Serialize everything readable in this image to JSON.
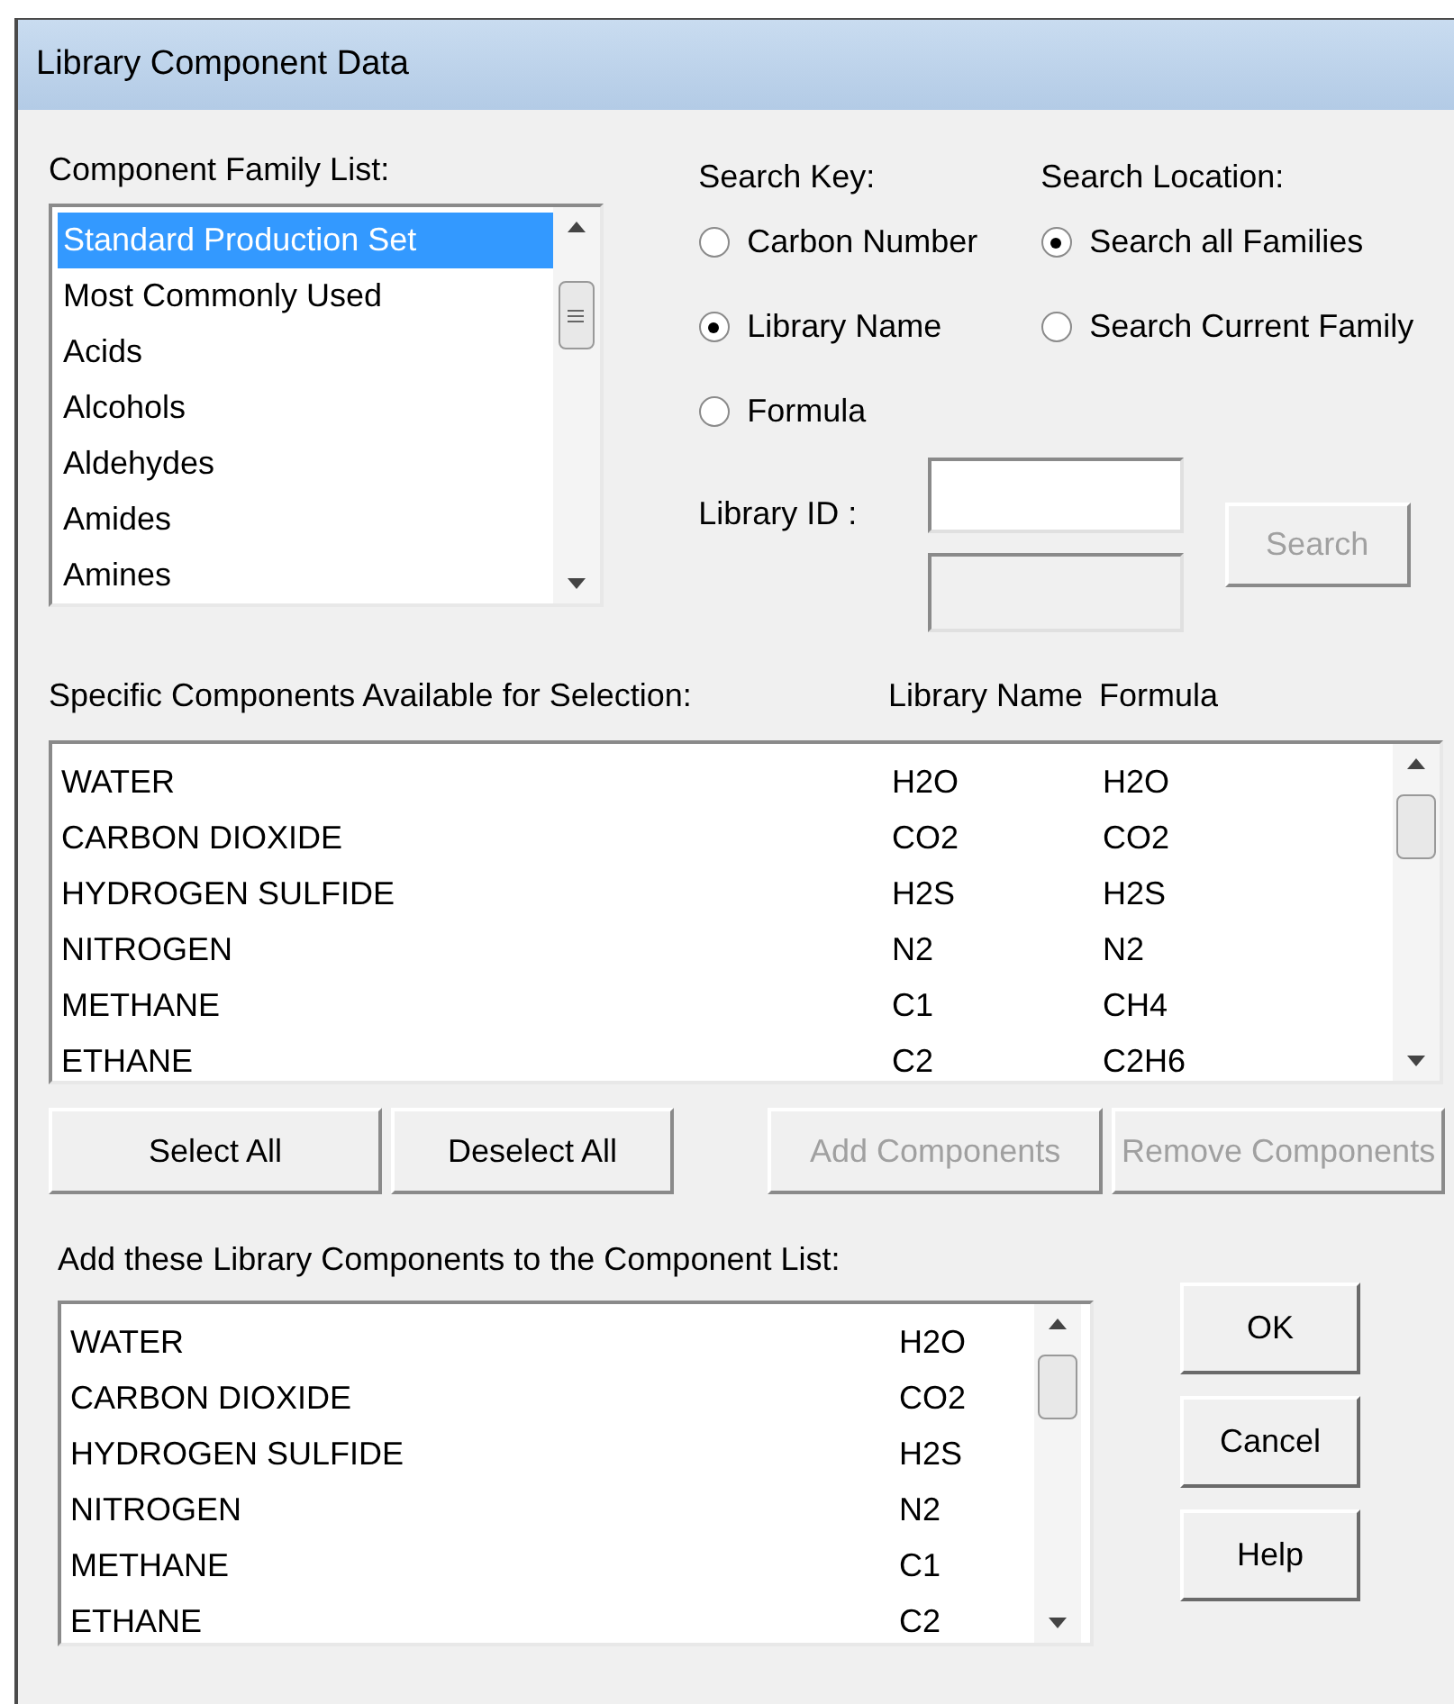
{
  "window": {
    "title": "Library Component Data"
  },
  "family_list": {
    "label": "Component Family List:",
    "items": [
      {
        "text": "Standard Production Set",
        "selected": true
      },
      {
        "text": "Most Commonly Used",
        "selected": false
      },
      {
        "text": "Acids",
        "selected": false
      },
      {
        "text": "Alcohols",
        "selected": false
      },
      {
        "text": "Aldehydes",
        "selected": false
      },
      {
        "text": "Amides",
        "selected": false
      },
      {
        "text": "Amines",
        "selected": false
      }
    ]
  },
  "search_key": {
    "label": "Search Key:",
    "options": [
      {
        "label": "Carbon Number",
        "selected": false
      },
      {
        "label": "Library Name",
        "selected": true
      },
      {
        "label": "Formula",
        "selected": false
      }
    ]
  },
  "search_location": {
    "label": "Search Location:",
    "options": [
      {
        "label": "Search all Families",
        "selected": true
      },
      {
        "label": "Search Current Family",
        "selected": false
      }
    ]
  },
  "library_id": {
    "label": "Library ID :"
  },
  "search_button": {
    "label": "Search",
    "disabled": true
  },
  "available": {
    "columns": [
      "Specific Components Available for Selection:",
      "Library Name",
      "Formula"
    ],
    "rows": [
      [
        "WATER",
        "H2O",
        "H2O"
      ],
      [
        "CARBON DIOXIDE",
        "CO2",
        "CO2"
      ],
      [
        "HYDROGEN SULFIDE",
        "H2S",
        "H2S"
      ],
      [
        "NITROGEN",
        "N2",
        "N2"
      ],
      [
        "METHANE",
        "C1",
        "CH4"
      ],
      [
        "ETHANE",
        "C2",
        "C2H6"
      ]
    ]
  },
  "buttons": [
    {
      "label": "Select All",
      "disabled": false
    },
    {
      "label": "Deselect All",
      "disabled": false
    },
    {
      "label": "Add Components",
      "disabled": true
    },
    {
      "label": "Remove Components",
      "disabled": true
    }
  ],
  "added": {
    "label": "Add these Library Components to the Component List:",
    "rows": [
      [
        "WATER",
        "H2O"
      ],
      [
        "CARBON DIOXIDE",
        "CO2"
      ],
      [
        "HYDROGEN SULFIDE",
        "H2S"
      ],
      [
        "NITROGEN",
        "N2"
      ],
      [
        "METHANE",
        "C1"
      ],
      [
        "ETHANE",
        "C2"
      ]
    ]
  },
  "dialog_buttons": [
    {
      "label": "OK"
    },
    {
      "label": "Cancel"
    },
    {
      "label": "Help"
    }
  ]
}
